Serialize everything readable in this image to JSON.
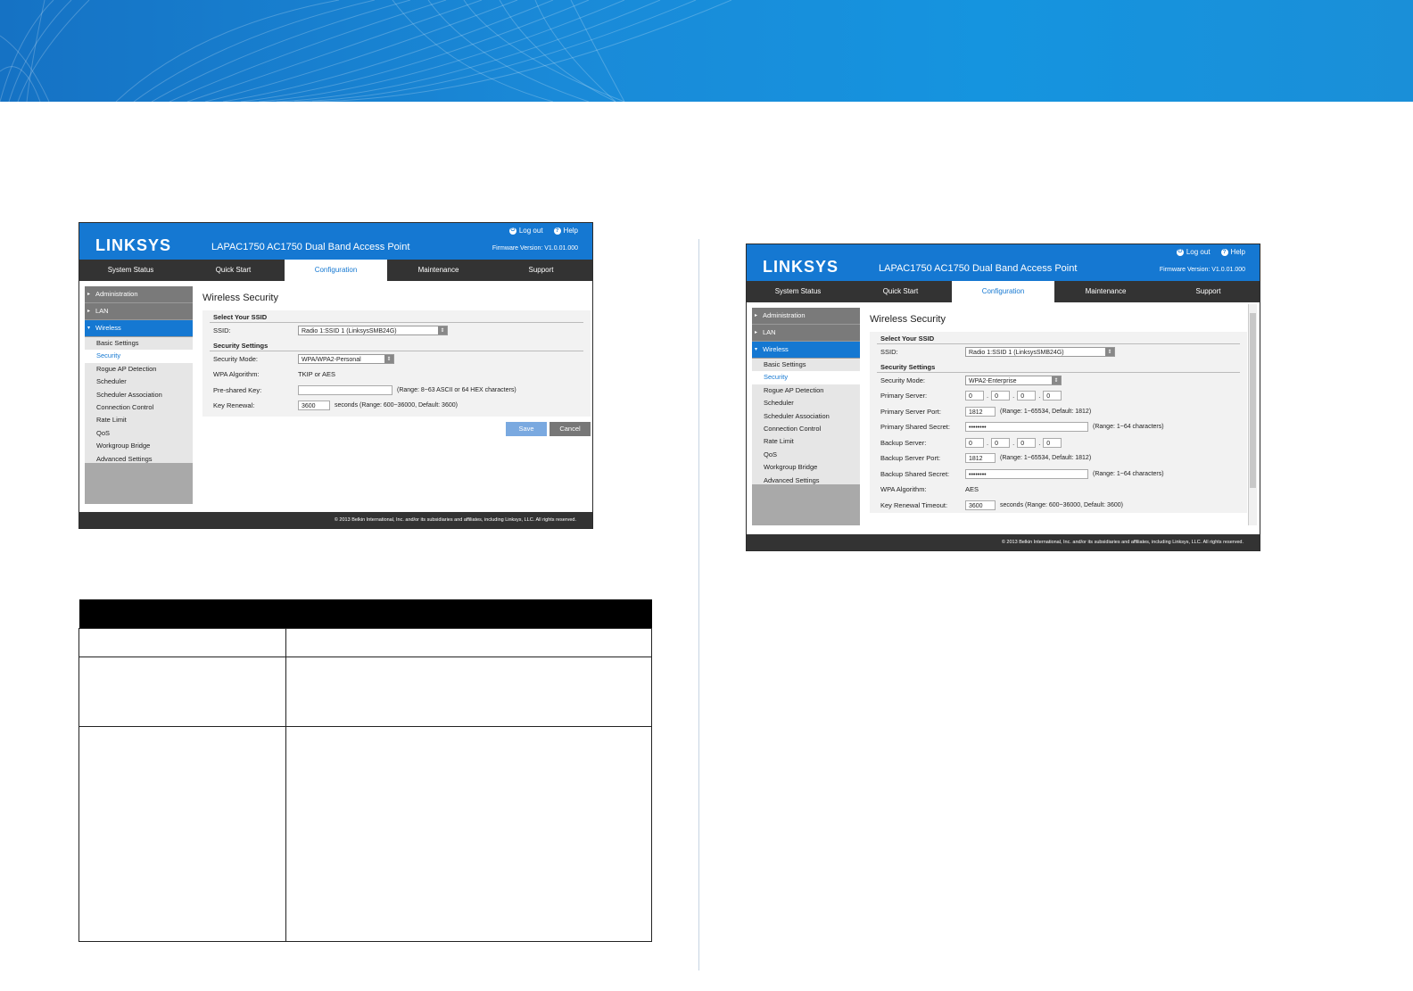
{
  "colors": {
    "brand_blue": "#1578d2",
    "banner_blue": "#1a8ad8",
    "nav_dark": "#333333"
  },
  "left_shot": {
    "logo": "LINKSYS",
    "device_title": "LAPAC1750 AC1750 Dual Band Access Point",
    "logout": "Log out",
    "help": "Help",
    "firmware": "Firmware Version: V1.0.01.000",
    "tabs": [
      "System Status",
      "Quick Start",
      "Configuration",
      "Maintenance",
      "Support"
    ],
    "sidebar_groups": [
      "Administration",
      "LAN",
      "Wireless"
    ],
    "sidebar_items": [
      "Basic Settings",
      "Security",
      "Rogue AP Detection",
      "Scheduler",
      "Scheduler Association",
      "Connection Control",
      "Rate Limit",
      "QoS",
      "Workgroup Bridge",
      "Advanced Settings"
    ],
    "page_title": "Wireless Security",
    "section_ssid": "Select Your SSID",
    "ssid_label": "SSID:",
    "ssid_value": "Radio 1:SSID 1 (LinksysSMB24G)",
    "section_security": "Security Settings",
    "mode_label": "Security Mode:",
    "mode_value": "WPA/WPA2-Personal",
    "algo_label": "WPA Algorithm:",
    "algo_value": "TKIP or AES",
    "psk_label": "Pre-shared Key:",
    "psk_hint": "(Range: 8~63 ASCII or 64 HEX characters)",
    "renew_label": "Key Renewal:",
    "renew_value": "3600",
    "renew_hint": "seconds (Range: 600~36000, Default: 3600)",
    "save": "Save",
    "cancel": "Cancel",
    "footer": "© 2013 Belkin International, Inc. and/or its subsidiaries and affiliates, including Linksys, LLC. All rights reserved."
  },
  "right_shot": {
    "logo": "LINKSYS",
    "device_title": "LAPAC1750 AC1750 Dual Band Access Point",
    "logout": "Log out",
    "help": "Help",
    "firmware": "Firmware Version: V1.0.01.000",
    "tabs": [
      "System Status",
      "Quick Start",
      "Configuration",
      "Maintenance",
      "Support"
    ],
    "sidebar_groups": [
      "Administration",
      "LAN",
      "Wireless"
    ],
    "sidebar_items": [
      "Basic Settings",
      "Security",
      "Rogue AP Detection",
      "Scheduler",
      "Scheduler Association",
      "Connection Control",
      "Rate Limit",
      "QoS",
      "Workgroup Bridge",
      "Advanced Settings"
    ],
    "page_title": "Wireless Security",
    "section_ssid": "Select Your SSID",
    "ssid_label": "SSID:",
    "ssid_value": "Radio 1:SSID 1 (LinksysSMB24G)",
    "section_security": "Security Settings",
    "mode_label": "Security Mode:",
    "mode_value": "WPA2-Enterprise",
    "primary_server_label": "Primary Server:",
    "primary_server_octets": [
      "0",
      "0",
      "0",
      "0"
    ],
    "primary_port_label": "Primary Server Port:",
    "primary_port_value": "1812",
    "primary_port_hint": "(Range: 1~65534, Default: 1812)",
    "primary_secret_label": "Primary Shared Secret:",
    "primary_secret_value": "••••••••",
    "primary_secret_hint": "(Range: 1~64 characters)",
    "backup_server_label": "Backup Server:",
    "backup_server_octets": [
      "0",
      "0",
      "0",
      "0"
    ],
    "backup_port_label": "Backup Server Port:",
    "backup_port_value": "1812",
    "backup_port_hint": "(Range: 1~65534, Default: 1812)",
    "backup_secret_label": "Backup Shared Secret:",
    "backup_secret_value": "••••••••",
    "backup_secret_hint": "(Range: 1~64 characters)",
    "algo_label": "WPA Algorithm:",
    "algo_value": "AES",
    "renew_label": "Key Renewal Timeout:",
    "renew_value": "3600",
    "renew_hint": "seconds (Range: 600~36000, Default: 3600)",
    "footer": "© 2013 Belkin International, Inc. and/or its subsidiaries and affiliates, including Linksys, LLC. All rights reserved."
  }
}
